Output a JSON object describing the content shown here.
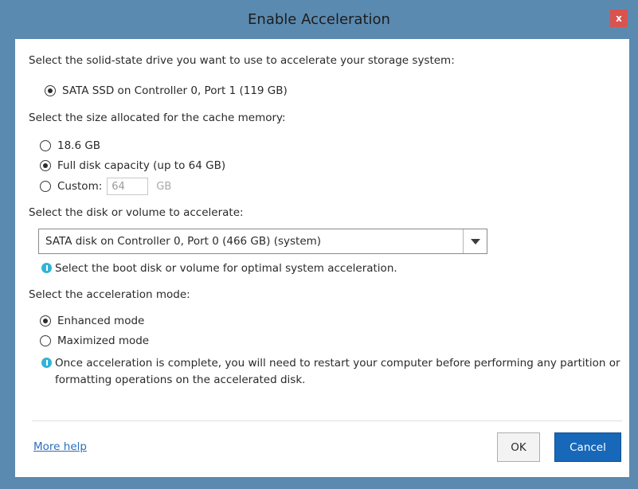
{
  "window": {
    "title": "Enable Acceleration",
    "close_label": "x"
  },
  "ssd_section": {
    "prompt": "Select the solid-state drive you want to use to accelerate your storage system:",
    "options": [
      {
        "label": "SATA SSD on Controller 0, Port 1 (119 GB)",
        "selected": true
      }
    ]
  },
  "cache_section": {
    "prompt": "Select the size allocated for the cache memory:",
    "options": [
      {
        "label": "18.6 GB",
        "selected": false
      },
      {
        "label": "Full disk capacity (up to 64 GB)",
        "selected": true
      },
      {
        "label": "Custom:",
        "selected": false
      }
    ],
    "custom_value": "64",
    "custom_unit": "GB"
  },
  "disk_section": {
    "prompt": "Select the disk or volume to accelerate:",
    "selected_value": "SATA disk on Controller 0, Port 0 (466 GB) (system)",
    "info": "Select the boot disk or volume for optimal system acceleration."
  },
  "mode_section": {
    "prompt": "Select the acceleration mode:",
    "options": [
      {
        "label": "Enhanced mode",
        "selected": true
      },
      {
        "label": "Maximized mode",
        "selected": false
      }
    ],
    "info_line1": "Once acceleration is complete, you will need to restart your computer before performing any partition or",
    "info_line2": "formatting operations on the accelerated disk."
  },
  "footer": {
    "help_link": "More help",
    "ok_label": "OK",
    "cancel_label": "Cancel"
  },
  "colors": {
    "frame": "#5b8ab0",
    "close": "#d9534f",
    "primary_button": "#1768b9",
    "link": "#2a6ebb",
    "info_icon": "#33b3d6"
  }
}
